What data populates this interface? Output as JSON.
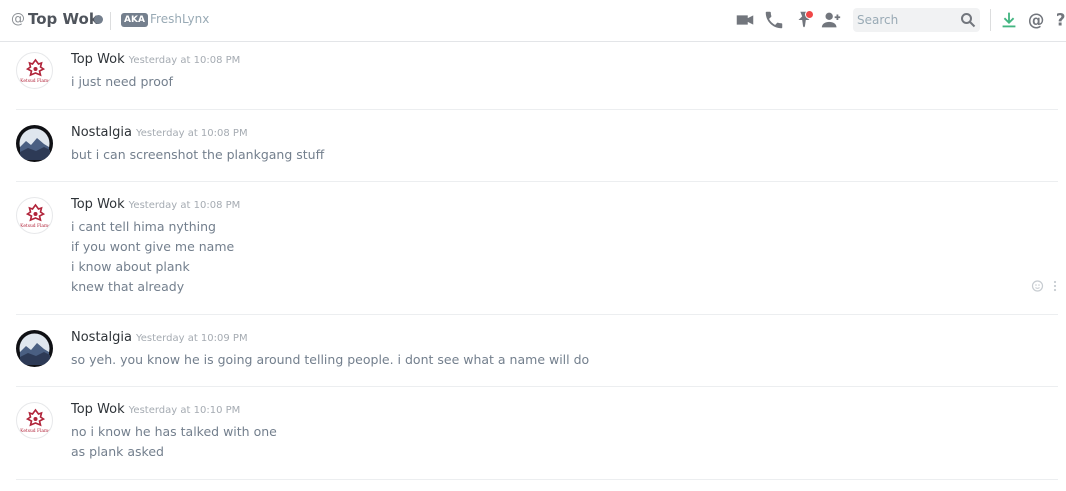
{
  "header": {
    "channel_title": "Top Wok",
    "aka_badge": "AKA",
    "alias": "FreshLynx",
    "search_placeholder": "Search",
    "icons": [
      "video-call-icon",
      "voice-call-icon",
      "pinned-messages-icon",
      "add-friend-icon",
      "search-icon",
      "download-icon",
      "mentions-icon",
      "help-icon"
    ]
  },
  "messages": [
    {
      "author": "Top Wok",
      "timestamp": "Yesterday at 10:08 PM",
      "lines": [
        "i just need proof"
      ]
    },
    {
      "author": "Nostalgia",
      "timestamp": "Yesterday at 10:08 PM",
      "lines": [
        "but i can screenshot the plankgang stuff"
      ]
    },
    {
      "author": "Top Wok",
      "timestamp": "Yesterday at 10:08 PM",
      "lines": [
        "i cant tell hima nything",
        "if you wont give me name",
        "i know about plank",
        "knew that already"
      ]
    },
    {
      "author": "Nostalgia",
      "timestamp": "Yesterday at 10:09 PM",
      "lines": [
        "so yeh. you know he is going around telling people. i dont see what a name will do"
      ]
    },
    {
      "author": "Top Wok",
      "timestamp": "Yesterday at 10:10 PM",
      "lines": [
        "no i know he has talked with one",
        "as plank asked"
      ]
    }
  ],
  "avatar_text": "Ketsud Flame",
  "colors": {
    "notification": "#f04747",
    "download": "#43b581",
    "text": "#737f8d",
    "author": "#2e3338"
  }
}
